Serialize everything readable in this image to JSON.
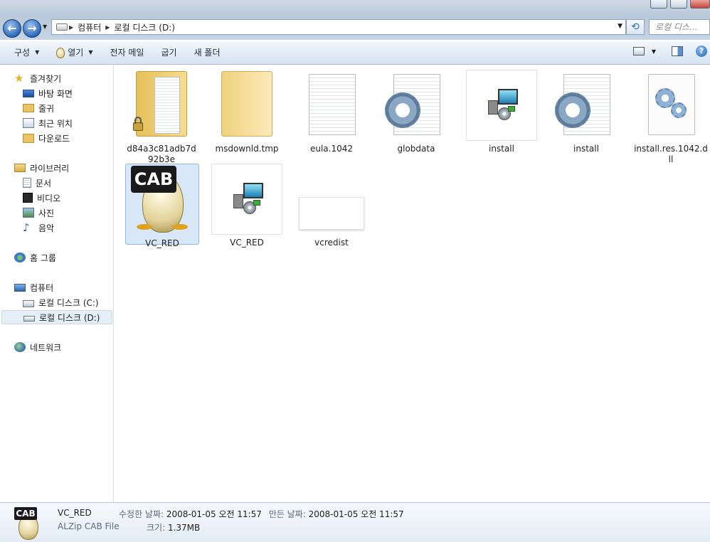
{
  "address": {
    "segments": [
      "컴퓨터",
      "로컬 디스크 (D:)"
    ],
    "search_placeholder": "로컬 디스..."
  },
  "toolbar": {
    "organize": "구성",
    "open": "열기",
    "email": "전자 메일",
    "burn": "굽기",
    "new_folder": "새 폴더"
  },
  "nav": {
    "favorites": "즐겨찾기",
    "desktop": "바탕 화면",
    "downloads_short": "줄귀",
    "recent": "최근 위치",
    "downloads": "다운로드",
    "libraries": "라이브러리",
    "documents": "문서",
    "videos": "비디오",
    "pictures": "사진",
    "music": "음악",
    "homegroup": "홈 그룹",
    "computer": "컴퓨터",
    "drive_c": "로컬 디스크 (C:)",
    "drive_d": "로컬 디스크 (D:)",
    "network": "네트워크"
  },
  "files": [
    {
      "name": "d84a3c81adb7d92b3e",
      "icon": "locked-folder"
    },
    {
      "name": "msdownld.tmp",
      "icon": "folder"
    },
    {
      "name": "eula.1042",
      "icon": "text-document"
    },
    {
      "name": "globdata",
      "icon": "gear-document"
    },
    {
      "name": "install",
      "icon": "installer"
    },
    {
      "name": "install",
      "icon": "gear-document"
    },
    {
      "name": "install.res.1042.dll",
      "icon": "dll-gear"
    },
    {
      "name": "VC_RED",
      "icon": "cab-archive"
    },
    {
      "name": "VC_RED",
      "icon": "installer"
    },
    {
      "name": "vcredist",
      "icon": "blank"
    }
  ],
  "details": {
    "name": "VC_RED",
    "type": "ALZip CAB File",
    "modified_label": "수정한 날짜:",
    "modified_value": "2008-01-05 오전 11:57",
    "created_label": "만든 날짜:",
    "created_value": "2008-01-05 오전 11:57",
    "size_label": "크기:",
    "size_value": "1.37MB",
    "cab_text": "CAB"
  },
  "colors": {
    "selection_bg": "#d9e8f9",
    "selection_border": "#8fb5df",
    "folder": "#f2d27a",
    "nav_selected": "#e6eef7"
  }
}
